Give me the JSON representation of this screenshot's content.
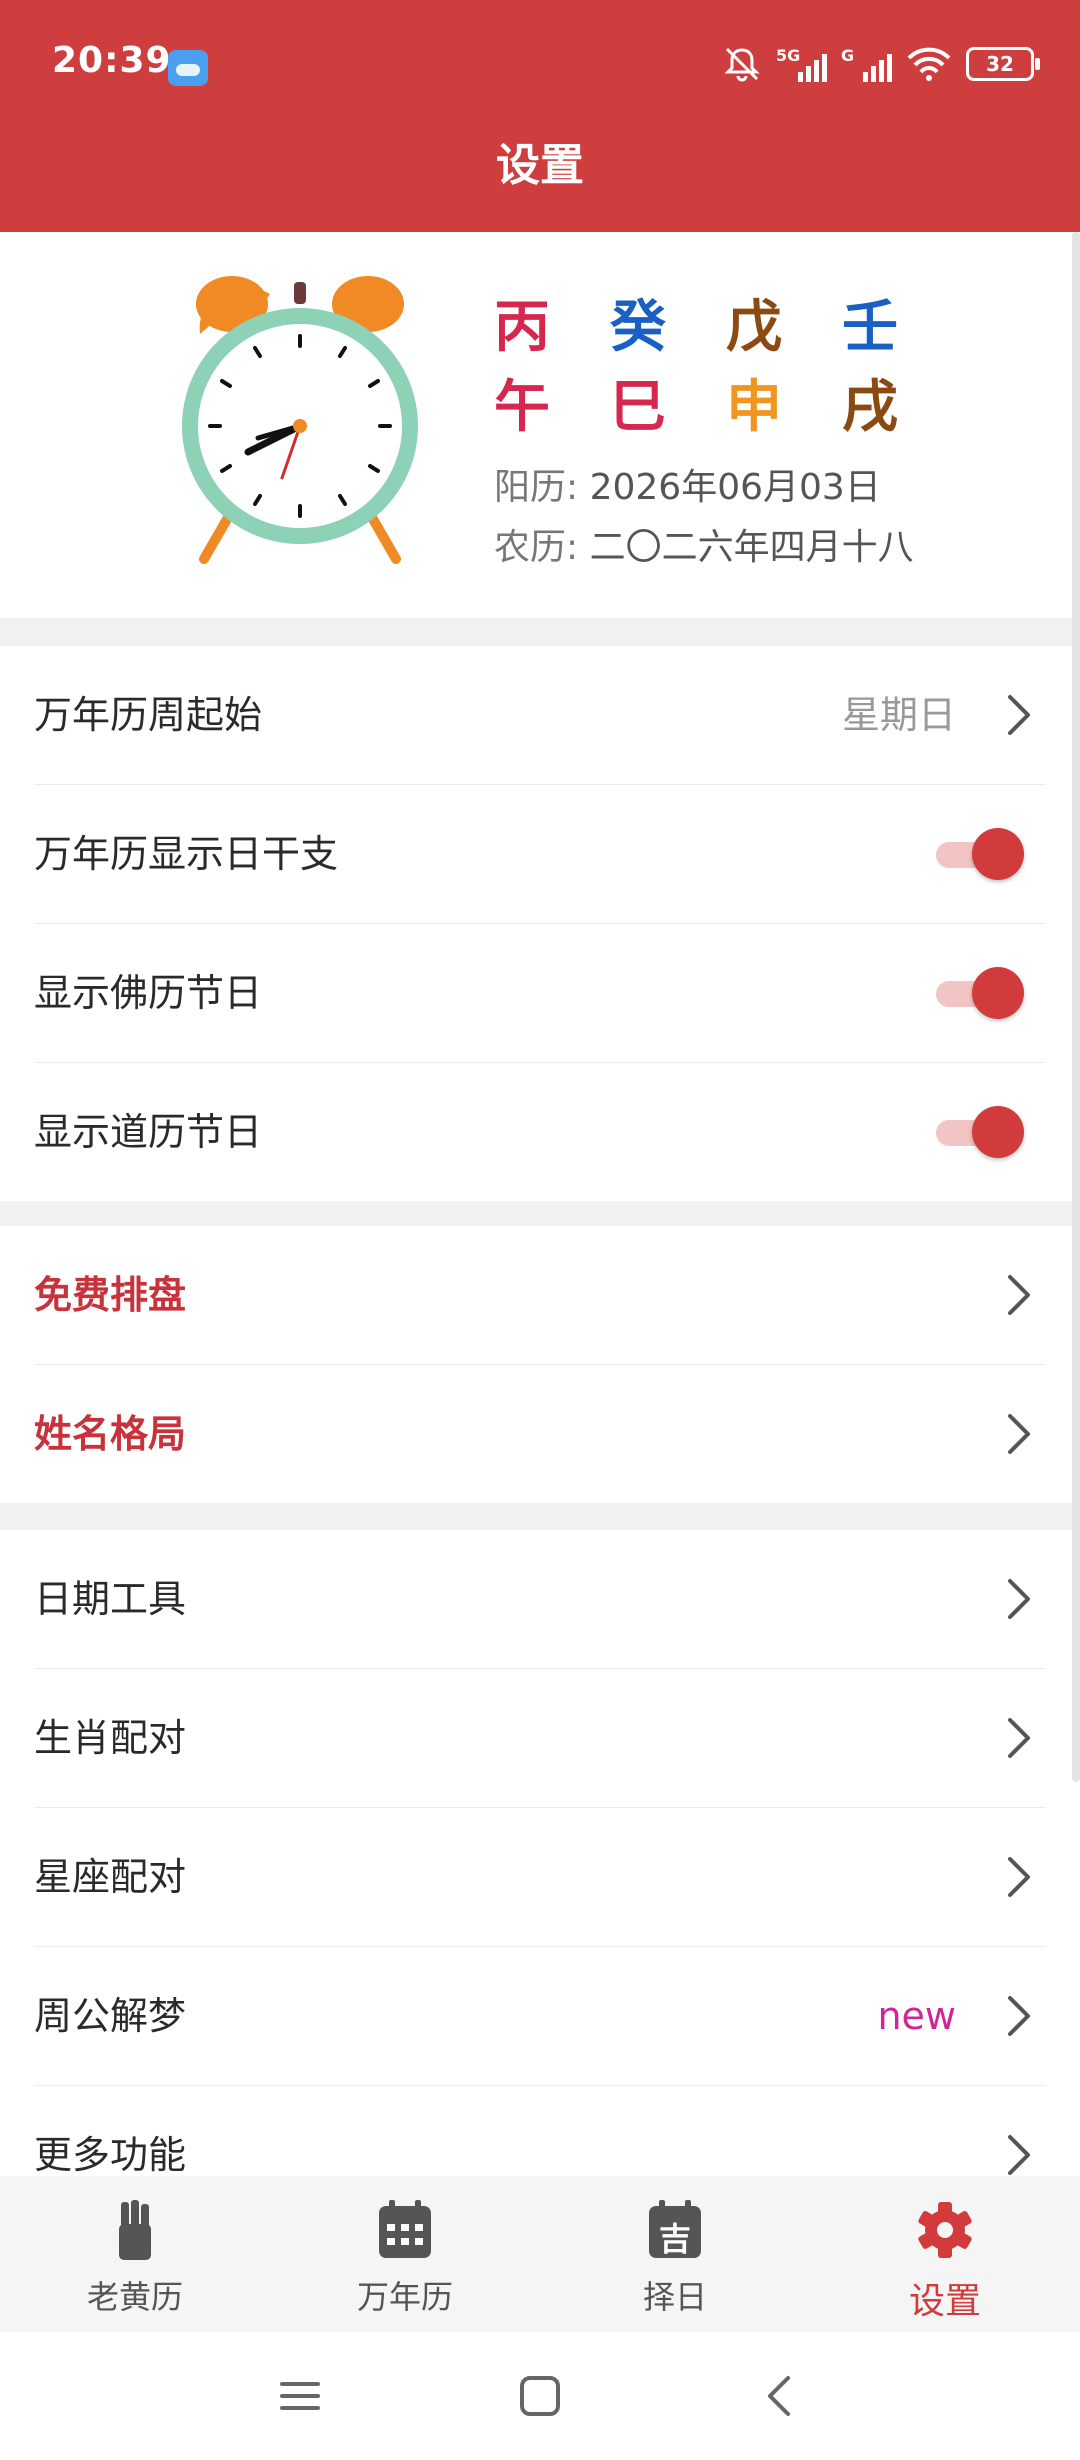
{
  "status_bar": {
    "time": "20:39",
    "battery": "32",
    "net1": "5G",
    "net2": "G"
  },
  "header": {
    "title": "设置"
  },
  "date_card": {
    "ganzhi_top": [
      {
        "char": "丙",
        "color": "#d6284f"
      },
      {
        "char": "癸",
        "color": "#1a5fc2"
      },
      {
        "char": "戊",
        "color": "#8a4a12"
      },
      {
        "char": "壬",
        "color": "#1a5fc2"
      }
    ],
    "ganzhi_bottom": [
      {
        "char": "午",
        "color": "#d6284f"
      },
      {
        "char": "巳",
        "color": "#d6284f"
      },
      {
        "char": "申",
        "color": "#f0961e"
      },
      {
        "char": "戌",
        "color": "#8a4a12"
      }
    ],
    "solar_label": "阳历:",
    "solar_date": "2026年06月03日",
    "lunar_label": "农历:",
    "lunar_date": "二〇二六年四月十八"
  },
  "settings_group_1": {
    "week_start_label": "万年历周起始",
    "week_start_value": "星期日",
    "show_day_ganzhi_label": "万年历显示日干支",
    "show_buddhist_label": "显示佛历节日",
    "show_taoist_label": "显示道历节日"
  },
  "settings_group_2": {
    "free_chart_label": "免费排盘",
    "name_pattern_label": "姓名格局"
  },
  "settings_group_3": {
    "date_tools_label": "日期工具",
    "zodiac_match_label": "生肖配对",
    "constellation_match_label": "星座配对",
    "dream_label": "周公解梦",
    "dream_badge": "new",
    "more_label": "更多功能"
  },
  "bottom_nav": {
    "items": [
      {
        "label": "老黄历"
      },
      {
        "label": "万年历"
      },
      {
        "label": "择日"
      },
      {
        "label": "设置"
      }
    ],
    "ze_ri_icon_char": "吉"
  },
  "colors": {
    "brand_red": "#cf3e3e",
    "toggle_on": "#d23b3b",
    "nav_icon": "#555555"
  }
}
